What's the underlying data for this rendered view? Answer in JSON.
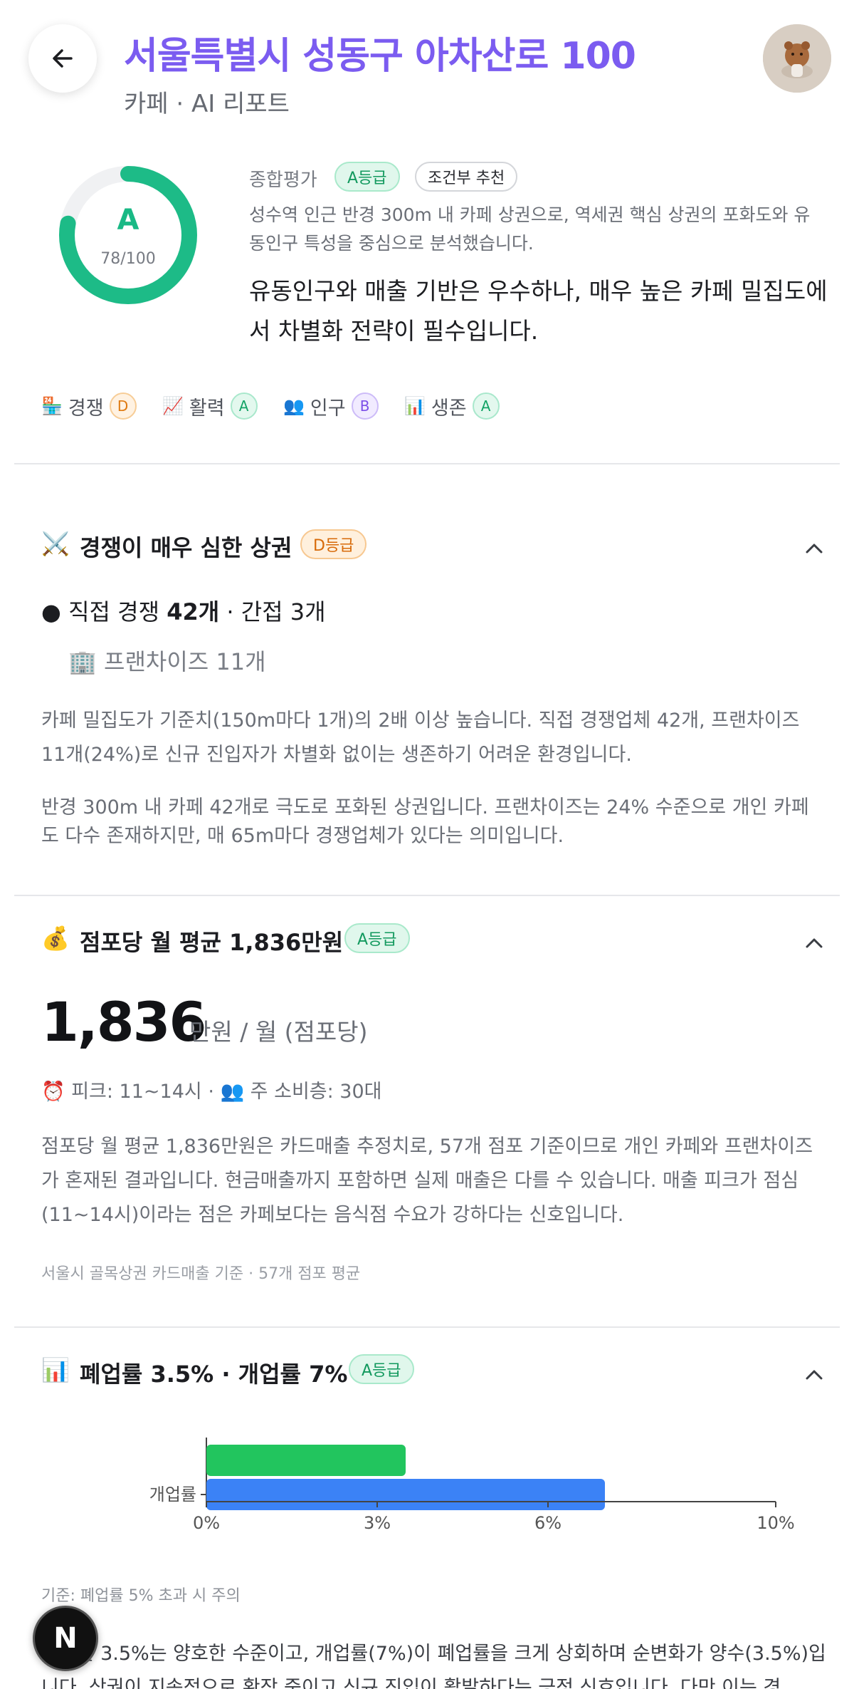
{
  "header": {
    "title": "서울특별시 성동구 아차산로 100",
    "subtitle": "카페 · AI 리포트"
  },
  "summary": {
    "grade": "A",
    "score_text": "78/100",
    "score": 78,
    "label": "종합평가",
    "grade_badge": "A등급",
    "recommend_badge": "조건부 추천",
    "description": "성수역 인근 반경 300m 내 카페 상권으로, 역세권 핵심 상권의 포화도와 유동인구 특성을 중심으로 분석했습니다.",
    "headline": "유동인구와 매출 기반은 우수하나, 매우 높은 카페 밀집도에서 차별화 전략이 필수입니다."
  },
  "metrics": [
    {
      "icon": "🏪",
      "label": "경쟁",
      "grade": "D"
    },
    {
      "icon": "📈",
      "label": "활력",
      "grade": "A"
    },
    {
      "icon": "👥",
      "label": "인구",
      "grade": "B"
    },
    {
      "icon": "📊",
      "label": "생존",
      "grade": "A"
    }
  ],
  "competition": {
    "icon": "⚔️",
    "title": "경쟁이 매우 심한 상권",
    "badge": "D등급",
    "direct_prefix": "● 직접 경쟁 ",
    "direct_count": "42개",
    "indirect": " · 간접 3개",
    "franchise": "🏢 프랜차이즈 11개",
    "paragraph1": "카페 밀집도가 기준치(150m마다 1개)의 2배 이상 높습니다. 직접 경쟁업체 42개, 프랜차이즈 11개(24%)로 신규 진입자가 차별화 없이는 생존하기 어려운 환경입니다.",
    "paragraph2": "반경 300m 내 카페 42개로 극도로 포화된 상권입니다. 프랜차이즈는 24% 수준으로 개인 카페도 다수 존재하지만, 매 65m마다 경쟁업체가 있다는 의미입니다."
  },
  "sales": {
    "icon": "💰",
    "title": "점포당 월 평균 1,836만원",
    "badge": "A등급",
    "big_number": "1,836",
    "unit": "만원 / 월 (점포당)",
    "peak": "⏰ 피크: 11~14시 · 👥 주 소비층: 30대",
    "paragraph": "점포당 월 평균 1,836만원은 카드매출 추정치로, 57개 점포 기준이므로 개인 카페와 프랜차이즈가 혼재된 결과입니다. 현금매출까지 포함하면 실제 매출은 다를 수 있습니다. 매출 피크가 점심(11~14시)이라는 점은 카페보다는 음식점 수요가 강하다는 신호입니다.",
    "source": "서울시 골목상권 카드매출 기준 · 57개 점포 평균"
  },
  "survival": {
    "icon": "📊",
    "title": "폐업률 3.5% · 개업률 7%",
    "badge": "A등급",
    "criteria": "기준: 폐업률 5% 초과 시 주의",
    "paragraph": "폐업률 3.5%는 양호한 수준이고, 개업률(7%)이 폐업률을 크게 상회하며 순변화가 양수(3.5%)입니다. 상권이 지속적으로 확장 중이고 신규 진입이 활발하다는 긍정 신호입니다. 다만 이는 경"
  },
  "chart_data": {
    "type": "bar",
    "orientation": "horizontal",
    "categories": [
      "폐업률",
      "개업률"
    ],
    "visible_category_labels": [
      "개업률"
    ],
    "values": [
      3.5,
      7
    ],
    "colors": [
      "#22c55e",
      "#3b82f6"
    ],
    "xlim": [
      0,
      10
    ],
    "x_ticks": [
      "0%",
      "3%",
      "6%",
      "10%"
    ],
    "x_tick_values": [
      0,
      3,
      6,
      10
    ]
  },
  "fab": {
    "label": "N"
  }
}
